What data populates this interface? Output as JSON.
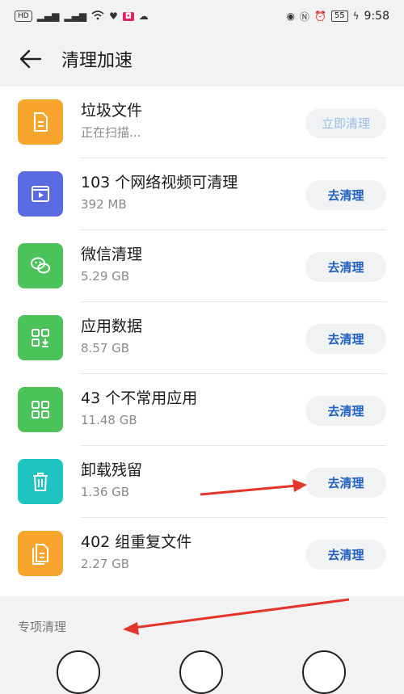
{
  "status_bar": {
    "left_badges": [
      "HD",
      "⁴⁶ᴳ",
      "⁴⁶ᴳ"
    ],
    "time": "9:58",
    "battery": "55"
  },
  "header": {
    "back_icon": "arrow-left-icon",
    "title": "清理加速"
  },
  "items": [
    {
      "title": "垃圾文件",
      "subtitle": "正在扫描...",
      "button": "立即清理",
      "icon": "document-icon",
      "icon_color": "#f7a52c",
      "disabled": true
    },
    {
      "title": "103 个网络视频可清理",
      "subtitle": "392 MB",
      "button": "去清理",
      "icon": "video-icon",
      "icon_color": "#5a6ae0",
      "disabled": false
    },
    {
      "title": "微信清理",
      "subtitle": "5.29 GB",
      "button": "去清理",
      "icon": "wechat-icon",
      "icon_color": "#4bc35a",
      "disabled": false
    },
    {
      "title": "应用数据",
      "subtitle": "8.57 GB",
      "button": "去清理",
      "icon": "app-data-icon",
      "icon_color": "#4bc35a",
      "disabled": false
    },
    {
      "title": "43 个不常用应用",
      "subtitle": "11.48 GB",
      "button": "去清理",
      "icon": "apps-grid-icon",
      "icon_color": "#4bc35a",
      "disabled": false
    },
    {
      "title": "卸载残留",
      "subtitle": "1.36 GB",
      "button": "去清理",
      "icon": "trash-icon",
      "icon_color": "#1fc3c0",
      "disabled": false
    },
    {
      "title": "402 组重复文件",
      "subtitle": "2.27 GB",
      "button": "去清理",
      "icon": "duplicate-file-icon",
      "icon_color": "#f7a52c",
      "disabled": false
    }
  ],
  "section": {
    "label": "专项清理"
  },
  "colors": {
    "button_text": "#1f5fbf",
    "annotation_arrow": "#e3342a"
  }
}
